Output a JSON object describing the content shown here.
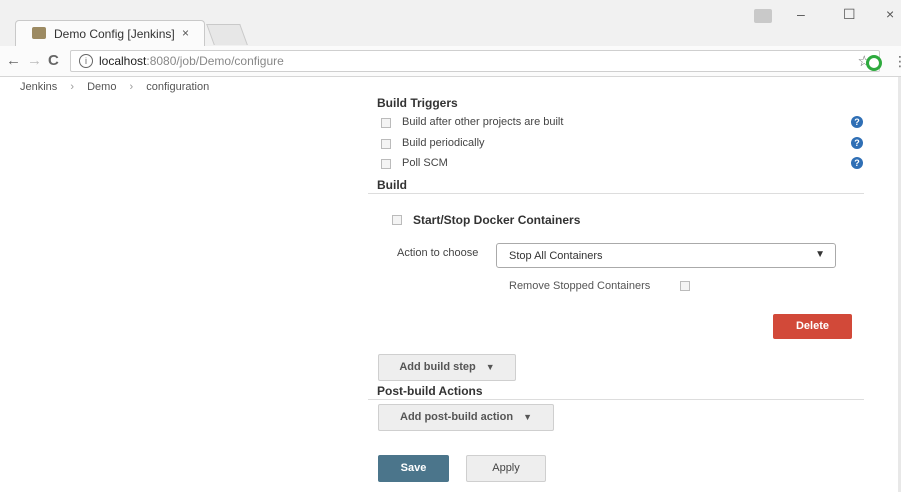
{
  "browser": {
    "tab_title": "Demo Config [Jenkins]",
    "tab_close": "×",
    "url_host": "localhost",
    "url_path": ":8080/job/Demo/configure",
    "window_controls": {
      "minimize": "–",
      "maximize": "☐",
      "close": "×"
    },
    "nav": {
      "back": "←",
      "forward": "→",
      "reload": "C"
    },
    "star": "☆",
    "menu": "⋮"
  },
  "breadcrumb": [
    "Jenkins",
    "Demo",
    "configuration"
  ],
  "breadcrumb_separator": "›",
  "build_triggers": {
    "title": "Build Triggers",
    "options": [
      {
        "label": "Build after other projects are built",
        "checked": false
      },
      {
        "label": "Build periodically",
        "checked": false
      },
      {
        "label": "Poll SCM",
        "checked": false
      }
    ],
    "help_symbol": "?"
  },
  "build": {
    "title": "Build",
    "step_title": "Start/Stop Docker Containers",
    "action_label": "Action to choose",
    "action_value": "Stop All Containers",
    "select_arrow": "▼",
    "remove_label": "Remove Stopped Containers",
    "delete_label": "Delete",
    "add_step_label": "Add build step"
  },
  "post_build": {
    "title": "Post-build Actions",
    "add_action_label": "Add post-build action"
  },
  "footer": {
    "save_label": "Save",
    "apply_label": "Apply"
  },
  "colors": {
    "delete": "#d24939",
    "save": "#4b758b",
    "help": "#2f6fb5"
  }
}
